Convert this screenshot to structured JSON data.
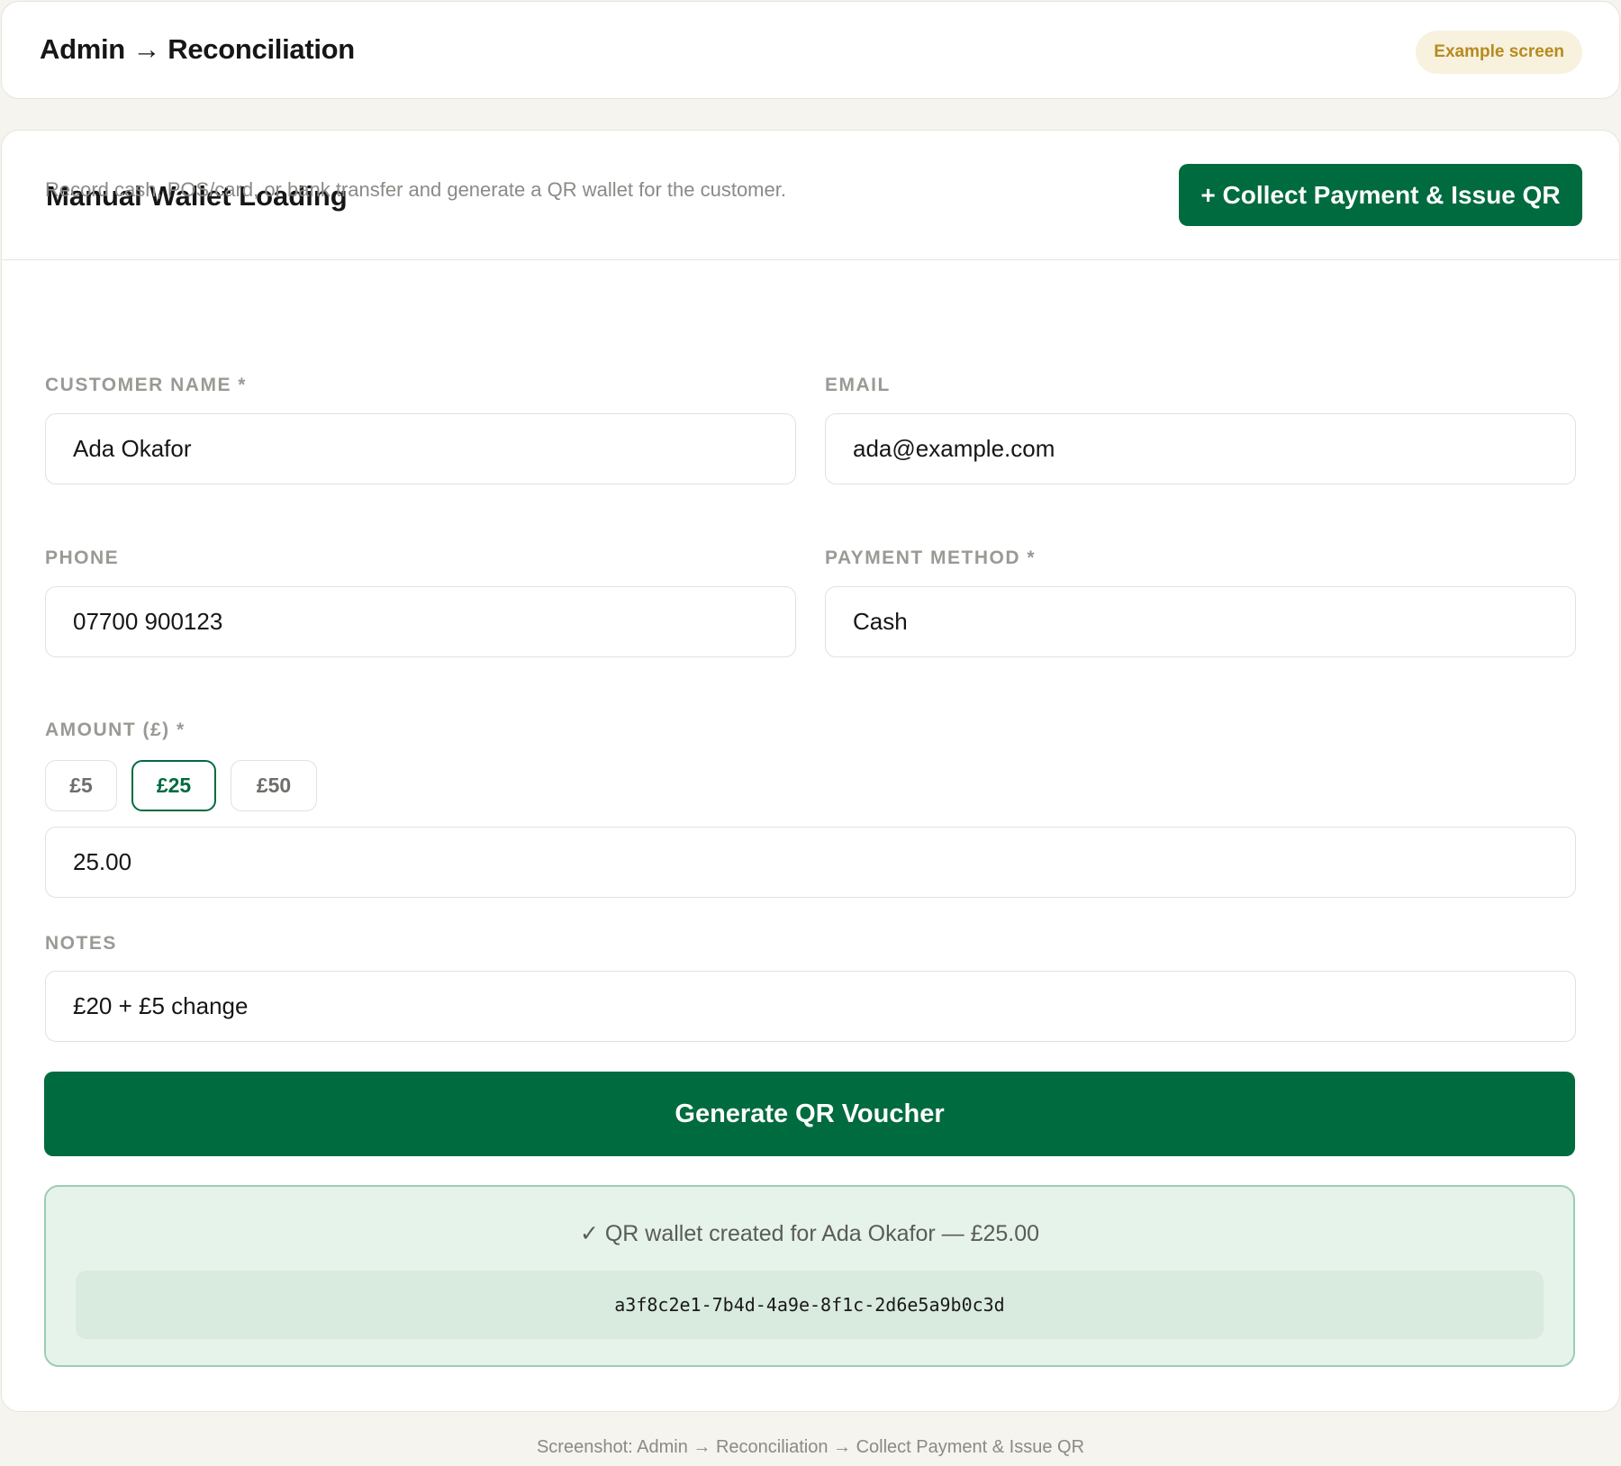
{
  "topbar": {
    "title": "Admin → Reconciliation",
    "badge": "Example screen"
  },
  "card": {
    "title": "Manual Wallet Loading",
    "collect_button": "+ Collect Payment & Issue QR",
    "intro": "Record cash, POS/card, or bank transfer and generate a QR wallet for the customer."
  },
  "form": {
    "customer_name": {
      "label": "CUSTOMER NAME *",
      "value": "Ada Okafor"
    },
    "email": {
      "label": "EMAIL",
      "value": "ada@example.com"
    },
    "phone": {
      "label": "PHONE",
      "value": "07700 900123"
    },
    "payment_method": {
      "label": "PAYMENT METHOD *",
      "value": "Cash"
    },
    "amount": {
      "label": "AMOUNT (£) *",
      "presets": [
        "£5",
        "£25",
        "£50"
      ],
      "selected_preset": "£25",
      "value": "25.00"
    },
    "notes": {
      "label": "NOTES",
      "value": "£20 + £5 change"
    },
    "generate_button": "Generate QR Voucher"
  },
  "result": {
    "message": "✓ QR wallet created for Ada Okafor — £25.00",
    "code": "a3f8c2e1-7b4d-4a9e-8f1c-2d6e5a9b0c3d"
  },
  "footer": "Screenshot: Admin → Reconciliation → Collect Payment & Issue QR",
  "colors": {
    "accent": "#006b3f",
    "badge_bg": "#f7f1de",
    "badge_text": "#b88a1c",
    "success_bg": "#e6f3ea",
    "success_border": "#9ccdb2",
    "page_bg": "#f5f4ef"
  }
}
